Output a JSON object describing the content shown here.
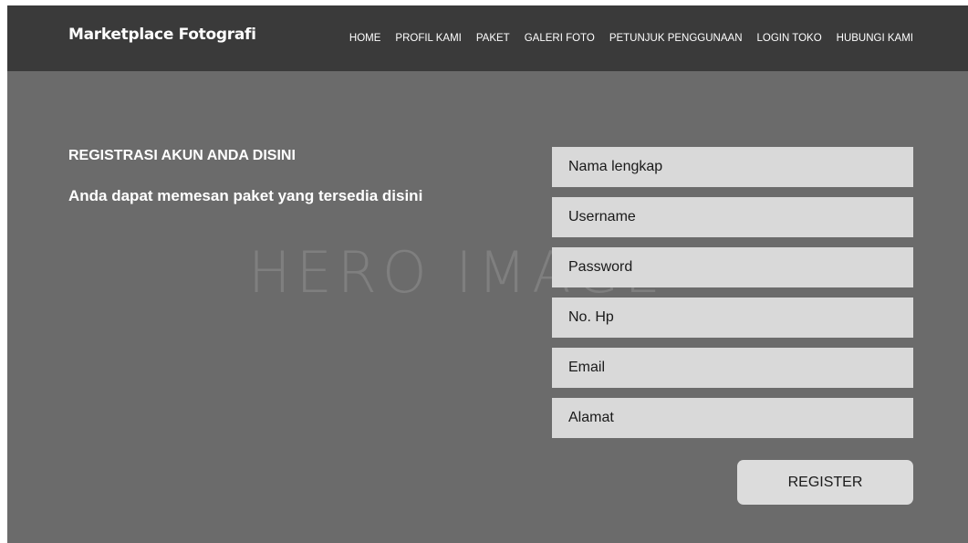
{
  "header": {
    "brand": "Marketplace Fotografi",
    "nav": [
      {
        "label": "HOME"
      },
      {
        "label": "PROFIL KAMI"
      },
      {
        "label": "PAKET"
      },
      {
        "label": "GALERI FOTO"
      },
      {
        "label": "PETUNJUK PENGGUNAAN"
      },
      {
        "label": "LOGIN TOKO"
      },
      {
        "label": "HUBUNGI KAMI"
      }
    ]
  },
  "hero": {
    "watermark": "HERO IMAGE",
    "title": "REGISTRASI AKUN ANDA DISINI",
    "subtitle": "Anda dapat memesan paket yang tersedia disini"
  },
  "form": {
    "fields": [
      {
        "placeholder": "Nama lengkap",
        "value": ""
      },
      {
        "placeholder": "Username",
        "value": ""
      },
      {
        "placeholder": "Password",
        "value": ""
      },
      {
        "placeholder": "No. Hp",
        "value": ""
      },
      {
        "placeholder": "Email",
        "value": ""
      },
      {
        "placeholder": "Alamat",
        "value": ""
      }
    ],
    "submit_label": "REGISTER"
  },
  "colors": {
    "navbar": "#3a3a3a",
    "hero_background": "#6b6b6b",
    "input_background": "#d9d9d9",
    "button_background": "#dcdcdc",
    "text_light": "#ffffff"
  }
}
